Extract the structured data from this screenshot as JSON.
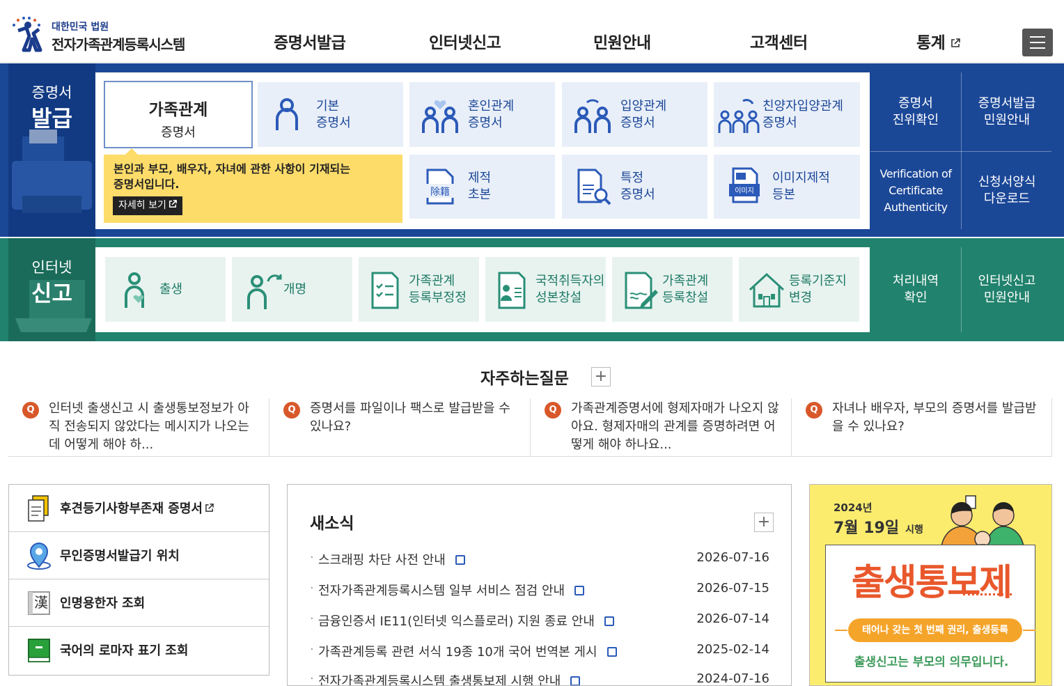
{
  "header": {
    "logo_line1": "대한민국 법원",
    "logo_line2": "전자가족관계등록시스템",
    "nav": [
      "증명서발급",
      "인터넷신고",
      "민원안내",
      "고객센터",
      "통계"
    ]
  },
  "cert": {
    "label1": "증명서",
    "label2": "발급",
    "selected_title": "가족관계",
    "selected_sub": "증명서",
    "tiles": [
      {
        "l1": "기본",
        "l2": "증명서"
      },
      {
        "l1": "혼인관계",
        "l2": "증명서"
      },
      {
        "l1": "입양관계",
        "l2": "증명서"
      },
      {
        "l1": "친양자입양관계",
        "l2": "증명서"
      },
      {
        "l1": "제적",
        "l2": "초본"
      },
      {
        "l1": "특정",
        "l2": "증명서"
      },
      {
        "l1": "이미지제적",
        "l2": "등본"
      }
    ],
    "tip_line1": "본인과 부모, 배우자, 자녀에 관한 사항이 기재되는",
    "tip_line2": "증명서입니다.",
    "tip_button": "자세히 보기",
    "side": [
      {
        "l1": "증명서",
        "l2": "진위확인"
      },
      {
        "l1": "증명서발급",
        "l2": "민원안내"
      },
      {
        "l1": "Verification of",
        "l2": "Certificate",
        "l3": "Authenticity"
      },
      {
        "l1": "신청서양식",
        "l2": "다운로드"
      }
    ],
    "icon_text_jejeok": "除籍",
    "icon_text_image": "이미지"
  },
  "report": {
    "label1": "인터넷",
    "label2": "신고",
    "tiles": [
      {
        "l1": "출생",
        "l2": ""
      },
      {
        "l1": "개명",
        "l2": ""
      },
      {
        "l1": "가족관계",
        "l2": "등록부정정"
      },
      {
        "l1": "국적취득자의",
        "l2": "성본창설"
      },
      {
        "l1": "가족관계",
        "l2": "등록창설"
      },
      {
        "l1": "등록기준지",
        "l2": "변경"
      }
    ],
    "side": [
      {
        "l1": "처리내역",
        "l2": "확인"
      },
      {
        "l1": "인터넷신고",
        "l2": "민원안내"
      }
    ]
  },
  "faq": {
    "title": "자주하는질문",
    "q_mark": "Q",
    "items": [
      "인터넷 출생신고 시 출생통보정보가 아직 전송되지 않았다는 메시지가 나오는데 어떻게 해야 하...",
      "증명서를 파일이나 팩스로 발급받을 수 있나요?",
      "가족관계증명서에 형제자매가 나오지 않아요. 형제자매의 관계를 증명하려면 어떻게 해야 하나요...",
      "자녀나 배우자, 부모의 증명서를 발급받을 수 있나요?"
    ]
  },
  "quick_links": [
    "후견등기사항부존재 증명서",
    "무인증명서발급기 위치",
    "인명용한자 조회",
    "국어의 로마자 표기 조회"
  ],
  "hanja_icon": "漢",
  "news": {
    "title": "새소식",
    "items": [
      {
        "title": "스크래핑 차단 사전 안내",
        "date": "2026-07-16"
      },
      {
        "title": "전자가족관계등록시스템 일부 서비스 점검 안내",
        "date": "2026-07-15"
      },
      {
        "title": "금융인증서 IE11(인터넷 익스플로러) 지원 종료 안내",
        "date": "2026-07-14"
      },
      {
        "title": "가족관계등록 관련 서식 19종 10개 국어 번역본 게시",
        "date": "2025-02-14"
      },
      {
        "title": "전자가족관계등록시스템 출생통보제 시행 안내",
        "date": "2024-07-16"
      }
    ]
  },
  "banner": {
    "year": "2024년",
    "date": "7월 19일",
    "suffix": "시행",
    "headline": "출생통보제",
    "pill": "태어나 갖는 첫 번째 권리, 출생등록",
    "footer": "출생신고는 부모의 의무입니다."
  },
  "colors": {
    "cert_band": "#1b4797",
    "report_band": "#21826d",
    "tip": "#fddc6a",
    "faq_q": "#d8582a"
  }
}
